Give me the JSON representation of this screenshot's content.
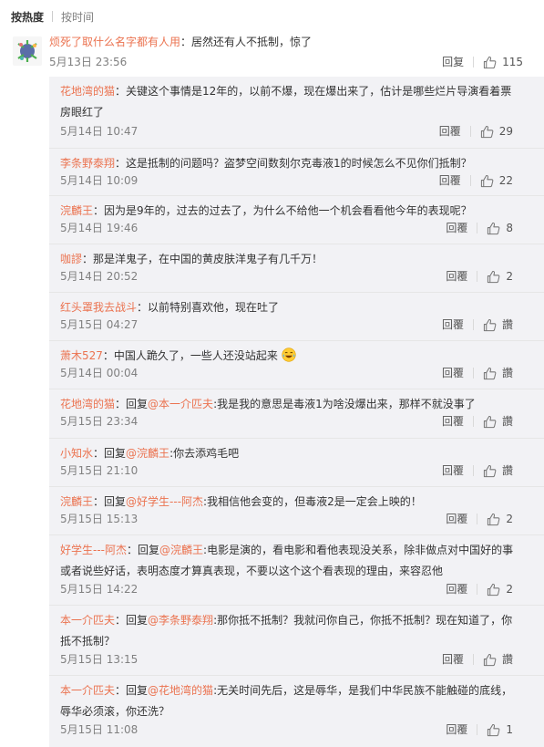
{
  "sort": {
    "hot": "按热度",
    "time": "按时间"
  },
  "main_comment": {
    "author": "烦死了取什么名字都有人用",
    "sep": "：",
    "text": "居然还有人不抵制，惊了",
    "time": "5月13日 23:56",
    "reply_label": "回复",
    "likes": "115"
  },
  "replies": [
    {
      "author": "花地湾的猫",
      "sep": "：",
      "text": "关键这个事情是12年的，以前不爆，现在爆出来了，估计是哪些烂片导演看着票房眼红了",
      "time": "5月14日 10:47",
      "reply_label": "回覆",
      "likes": "29"
    },
    {
      "author": "李条野泰翔",
      "sep": "：",
      "text": "这是抵制的问题吗？盗梦空间数刻尔克毒液1的时候怎么不见你们抵制？",
      "time": "5月14日 10:09",
      "reply_label": "回覆",
      "likes": "22"
    },
    {
      "author": "浣麟王",
      "sep": "：",
      "text": "因为是9年的，过去的过去了，为什么不给他一个机会看看他今年的表现呢？",
      "time": "5月14日 19:46",
      "reply_label": "回覆",
      "likes": "8"
    },
    {
      "author": "咖謬",
      "sep": "：",
      "text": "那是洋鬼子，在中国的黄皮肤洋鬼子有几千万！",
      "time": "5月14日 20:52",
      "reply_label": "回覆",
      "likes": "2"
    },
    {
      "author": "红头罩我去战斗",
      "sep": "：",
      "text": "以前特别喜欢他，现在吐了",
      "time": "5月15日 04:27",
      "reply_label": "回覆",
      "likes": "讚"
    },
    {
      "author": "萧木527",
      "sep": "：",
      "text": "中国人跪久了，一些人还没站起来",
      "time": "5月14日 00:04",
      "reply_label": "回覆",
      "likes": "讚",
      "emoji": "laugh-cry-emoji"
    },
    {
      "author": "花地湾的猫",
      "sep": "：",
      "pre": "回复",
      "mention": "@本一介匹夫",
      "text": ":我是我的意思是毒液1为啥没爆出来，那样不就没事了",
      "time": "5月15日 23:34",
      "reply_label": "回覆",
      "likes": "讚"
    },
    {
      "author": "小知水",
      "sep": "：",
      "pre": "回复",
      "mention": "@浣麟王",
      "text": ":你去添鸡毛吧",
      "time": "5月15日 21:10",
      "reply_label": "回覆",
      "likes": "讚"
    },
    {
      "author": "浣麟王",
      "sep": "：",
      "pre": "回复",
      "mention": "@好学生---阿杰",
      "text": ":我相信他会变的，但毒液2是一定会上映的！",
      "time": "5月15日 15:13",
      "reply_label": "回覆",
      "likes": "2"
    },
    {
      "author": "好学生---阿杰",
      "sep": "：",
      "pre": "回复",
      "mention": "@浣麟王",
      "text": ":电影是演的，看电影和看他表现没关系，除非做点对中国好的事或者说些好话，表明态度才算真表现，不要以这个这个看表现的理由，来容忍他",
      "time": "5月15日 14:22",
      "reply_label": "回覆",
      "likes": "2"
    },
    {
      "author": "本一介匹夫",
      "sep": "：",
      "pre": "回复",
      "mention": "@李条野泰翔",
      "text": ":那你抵不抵制？我就问你自己，你抵不抵制？现在知道了，你抵不抵制？",
      "time": "5月15日 13:15",
      "reply_label": "回覆",
      "likes": "讚"
    },
    {
      "author": "本一介匹夫",
      "sep": "：",
      "pre": "回复",
      "mention": "@花地湾的猫",
      "text": ":无关时间先后，这是辱华，是我们中华民族不能触碰的底线，辱华必须滚，你还洗？",
      "time": "5月15日 11:08",
      "reply_label": "回覆",
      "likes": "1"
    }
  ]
}
